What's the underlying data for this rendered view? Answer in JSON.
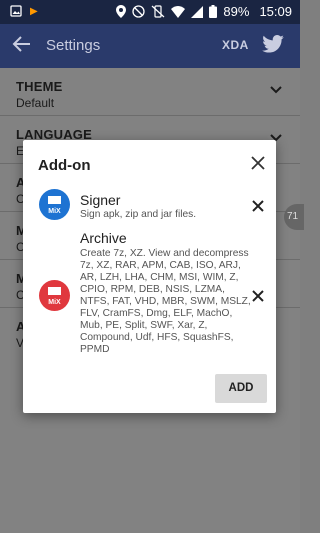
{
  "status_bar": {
    "battery": "89%",
    "time": "15:09"
  },
  "app_bar": {
    "title": "Settings",
    "xda_label": "XDA"
  },
  "settings": [
    {
      "title": "THEME",
      "value": "Default"
    },
    {
      "title": "LANGUAGE",
      "value": "E"
    },
    {
      "title": "A",
      "value": "C"
    },
    {
      "title": "M",
      "value": "C"
    },
    {
      "title": "M",
      "value": "C"
    },
    {
      "title": "A",
      "value": "V"
    }
  ],
  "side_bubble": "71",
  "dialog": {
    "title": "Add-on",
    "addons": [
      {
        "name": "Signer",
        "description": "Sign apk, zip and jar files.",
        "icon_color": "#1e73d2",
        "icon_label": "MiX"
      },
      {
        "name": "Archive",
        "description": "Create 7z, XZ. View and decompress 7z, XZ, RAR, APM, CAB, ISO, ARJ, AR, LZH, LHA, CHM, MSI, WIM, Z, CPIO, RPM, DEB, NSIS, LZMA, NTFS, FAT, VHD, MBR, SWM, MSLZ, FLV, CramFS, Dmg, ELF, MachO, Mub, PE, Split, SWF, Xar, Z, Compound, Udf, HFS, SquashFS, PPMD",
        "icon_color": "#e0383e",
        "icon_label": "MiX"
      }
    ],
    "add_label": "ADD"
  },
  "colors": {
    "status_bar": "#1a2542",
    "app_bar": "#2a3a6b",
    "backdrop": "#828282"
  }
}
